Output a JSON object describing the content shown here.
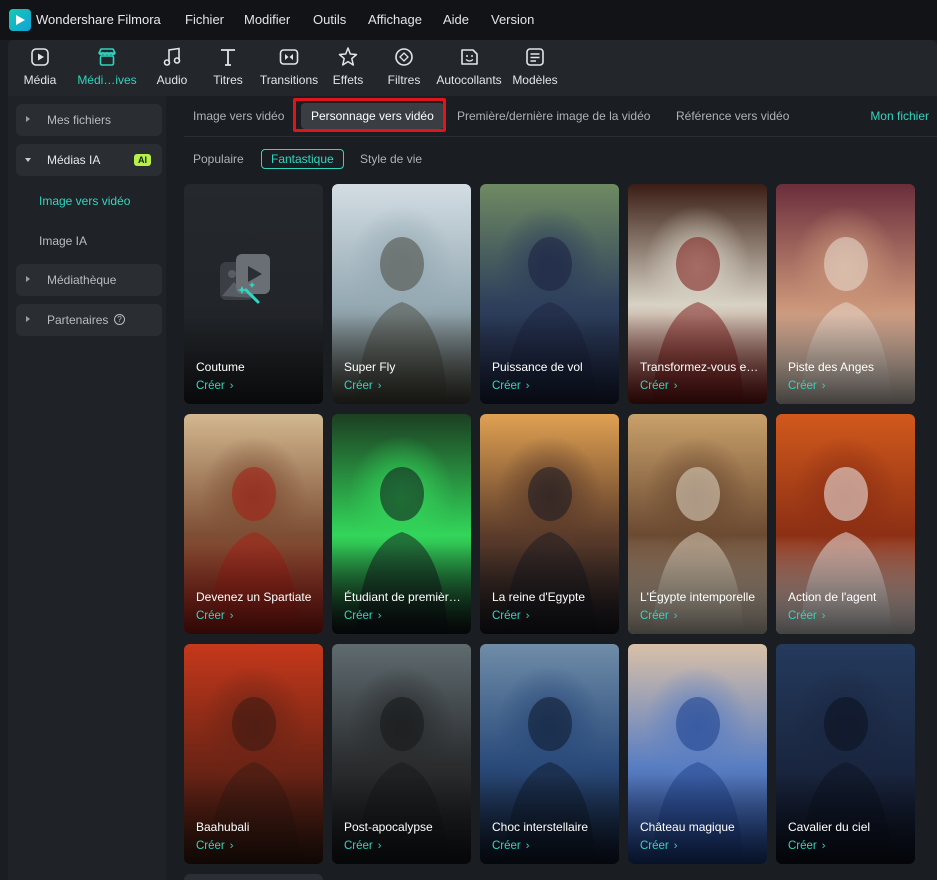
{
  "app": {
    "name": "Wondershare Filmora"
  },
  "menu": [
    "Fichier",
    "Modifier",
    "Outils",
    "Affichage",
    "Aide",
    "Version"
  ],
  "toolbar": [
    {
      "label": "Média",
      "icon": "media-icon"
    },
    {
      "label": "Médi…ives",
      "icon": "store-icon"
    },
    {
      "label": "Audio",
      "icon": "music-note-icon"
    },
    {
      "label": "Titres",
      "icon": "text-t-icon"
    },
    {
      "label": "Transitions",
      "icon": "transition-icon"
    },
    {
      "label": "Effets",
      "icon": "effects-icon"
    },
    {
      "label": "Filtres",
      "icon": "filter-icon"
    },
    {
      "label": "Autocollants",
      "icon": "sticker-icon"
    },
    {
      "label": "Modèles",
      "icon": "template-icon"
    }
  ],
  "sidebar": {
    "mes_fichiers": "Mes fichiers",
    "medias_ia": "Médias IA",
    "ai_badge": "AI",
    "image_vers_video": "Image vers vidéo",
    "image_ia": "Image IA",
    "mediatheque": "Médiathèque",
    "partenaires": "Partenaires",
    "help_glyph": "?"
  },
  "tabs": [
    "Image vers vidéo",
    "Personnage vers vidéo",
    "Première/dernière image de la vidéo",
    "Référence vers vidéo"
  ],
  "mon_fichier": "Mon fichier",
  "filters": [
    "Populaire",
    "Fantastique",
    "Style de vie"
  ],
  "cards": [
    {
      "title": "Coutume",
      "cta": "Créer",
      "theme": "custom"
    },
    {
      "title": "Super Fly",
      "cta": "Créer",
      "colors": [
        "#d3dde3",
        "#95a9b3",
        "#4a4a40"
      ]
    },
    {
      "title": "Puissance de vol",
      "cta": "Créer",
      "colors": [
        "#6f8a62",
        "#2e3f5c",
        "#1b2340"
      ]
    },
    {
      "title": "Transformez-vous e…",
      "cta": "Créer",
      "colors": [
        "#3a1d14",
        "#d8d3c5",
        "#7a1816"
      ]
    },
    {
      "title": "Piste des Anges",
      "cta": "Créer",
      "colors": [
        "#6a2e3c",
        "#c99478",
        "#e9ded3"
      ]
    },
    {
      "title": "Devenez un Spartiate",
      "cta": "Créer",
      "colors": [
        "#d2b890",
        "#7d4e34",
        "#a51d16"
      ]
    },
    {
      "title": "Étudiant de premièr…",
      "cta": "Créer",
      "colors": [
        "#1c3f22",
        "#33d65a",
        "#101419"
      ]
    },
    {
      "title": "La reine d'Egypte",
      "cta": "Créer",
      "colors": [
        "#e0a152",
        "#5b3b2a",
        "#1a1a22"
      ]
    },
    {
      "title": "L'Égypte intemporelle",
      "cta": "Créer",
      "colors": [
        "#c9a06a",
        "#6b4a32",
        "#e2d8c6"
      ]
    },
    {
      "title": "Action de l'agent",
      "cta": "Créer",
      "colors": [
        "#d1591c",
        "#8c2f14",
        "#f0f0f0"
      ]
    },
    {
      "title": "Baahubali",
      "cta": "Créer",
      "colors": [
        "#c5381b",
        "#6d2415",
        "#3a1a12"
      ]
    },
    {
      "title": "Post-apocalypse",
      "cta": "Créer",
      "colors": [
        "#5f6b70",
        "#2a2c2e",
        "#15171a"
      ]
    },
    {
      "title": "Choc interstellaire",
      "cta": "Créer",
      "colors": [
        "#6f8ca8",
        "#2a4a7a",
        "#0f1a2c"
      ]
    },
    {
      "title": "Château magique",
      "cta": "Créer",
      "colors": [
        "#d9c0a8",
        "#5a7ec2",
        "#1d3f8a"
      ]
    },
    {
      "title": "Cavalier du ciel",
      "cta": "Créer",
      "colors": [
        "#243a5c",
        "#1a2640",
        "#0b111f"
      ]
    }
  ],
  "accent": "#31d6c0",
  "highlight": "#e0141b"
}
